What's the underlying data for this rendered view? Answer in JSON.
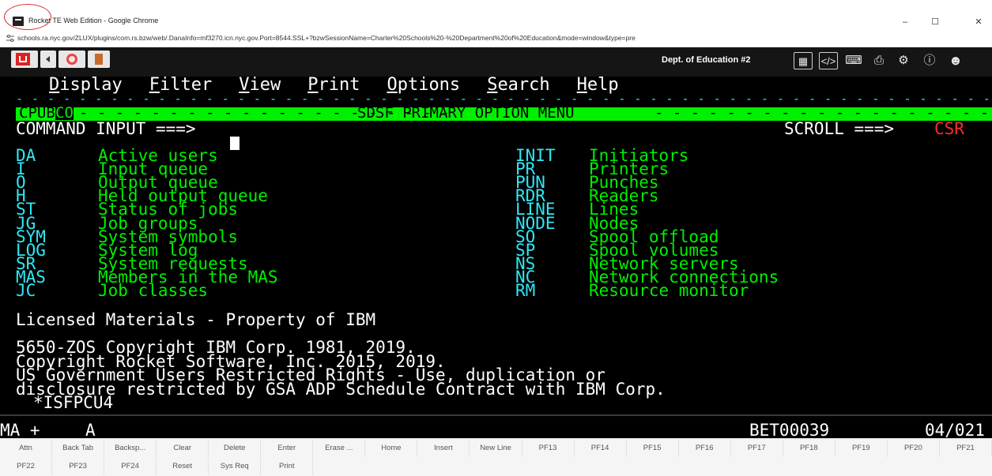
{
  "window": {
    "title": "Rocket TE Web Edition - Google Chrome",
    "minimize_icon": "minimize-icon",
    "maximize_icon": "maximize-icon",
    "close_icon": "close-icon"
  },
  "url": "schools.ra.nyc.gov/ZLUX/plugins/com.rs.bzw/web/.DanaInfo=mf3270.icn.nyc.gov.Port=8544.SSL+?bzwSessionName=Charter%20Schools%20-%20Department%20of%20Education&mode=window&type=pre",
  "toolbar": {
    "session_name": "Dept. of Education #2",
    "icons": [
      "grid-icon",
      "code-icon",
      "keyboard-icon",
      "printer-icon",
      "settings-icon",
      "info-icon",
      "user-icon"
    ]
  },
  "terminal": {
    "menu": [
      {
        "letter": "D",
        "rest": "isplay"
      },
      {
        "letter": "F",
        "rest": "ilter"
      },
      {
        "letter": "V",
        "rest": "iew"
      },
      {
        "letter": "P",
        "rest": "rint"
      },
      {
        "letter": "O",
        "rest": "ptions"
      },
      {
        "letter": "S",
        "rest": "earch"
      },
      {
        "letter": "H",
        "rest": "elp"
      }
    ],
    "system_id": "CPUB",
    "system_suffix": "CO",
    "screen_title": "SDSF PRIMARY OPTION MENU",
    "command_label": "COMMAND INPUT ===>",
    "command_value": "",
    "scroll_label": "SCROLL ===>",
    "scroll_value": "CSR",
    "options_left": [
      {
        "code": "DA",
        "desc": "Active users"
      },
      {
        "code": "I",
        "desc": "Input queue"
      },
      {
        "code": "O",
        "desc": "Output queue"
      },
      {
        "code": "H",
        "desc": "Held output queue"
      },
      {
        "code": "ST",
        "desc": "Status of jobs"
      },
      {
        "code": "JG",
        "desc": "Job groups"
      },
      {
        "code": "SYM",
        "desc": "System symbols"
      },
      {
        "code": "LOG",
        "desc": "System log"
      },
      {
        "code": "SR",
        "desc": "System requests"
      },
      {
        "code": "MAS",
        "desc": "Members in the MAS"
      },
      {
        "code": "JC",
        "desc": "Job classes"
      }
    ],
    "options_right": [
      {
        "code": "INIT",
        "desc": "Initiators"
      },
      {
        "code": "PR",
        "desc": "Printers"
      },
      {
        "code": "PUN",
        "desc": "Punches"
      },
      {
        "code": "RDR",
        "desc": "Readers"
      },
      {
        "code": "LINE",
        "desc": "Lines"
      },
      {
        "code": "NODE",
        "desc": "Nodes"
      },
      {
        "code": "SO",
        "desc": "Spool offload"
      },
      {
        "code": "SP",
        "desc": "Spool volumes"
      },
      {
        "code": "NS",
        "desc": "Network servers"
      },
      {
        "code": "NC",
        "desc": "Network connections"
      },
      {
        "code": "RM",
        "desc": "Resource monitor"
      }
    ],
    "license": "Licensed Materials - Property of IBM",
    "copyright_lines": [
      "5650-ZOS Copyright IBM Corp. 1981, 2019.",
      "Copyright Rocket Software, Inc. 2015, 2019.",
      "US Government Users Restricted Rights - Use, duplication or",
      "disclosure restricted by GSA ADP Schedule Contract with IBM Corp."
    ],
    "panel_id": "*ISFPCU4"
  },
  "status": {
    "left": "MA +",
    "mode": "A",
    "lu_name": "BET00039",
    "position": "04/021"
  },
  "keypad": {
    "row1": [
      "Attn",
      "Back Tab",
      "Backsp...",
      "Clear",
      "Delete",
      "Enter",
      "Erase ...",
      "Home",
      "Insert",
      "New Line",
      "PF13",
      "PF14",
      "PF15",
      "PF16",
      "PF17",
      "PF18",
      "PF19",
      "PF20",
      "PF21"
    ],
    "row2": [
      "PF22",
      "PF23",
      "PF24",
      "Reset",
      "Sys Req",
      "Print"
    ]
  }
}
